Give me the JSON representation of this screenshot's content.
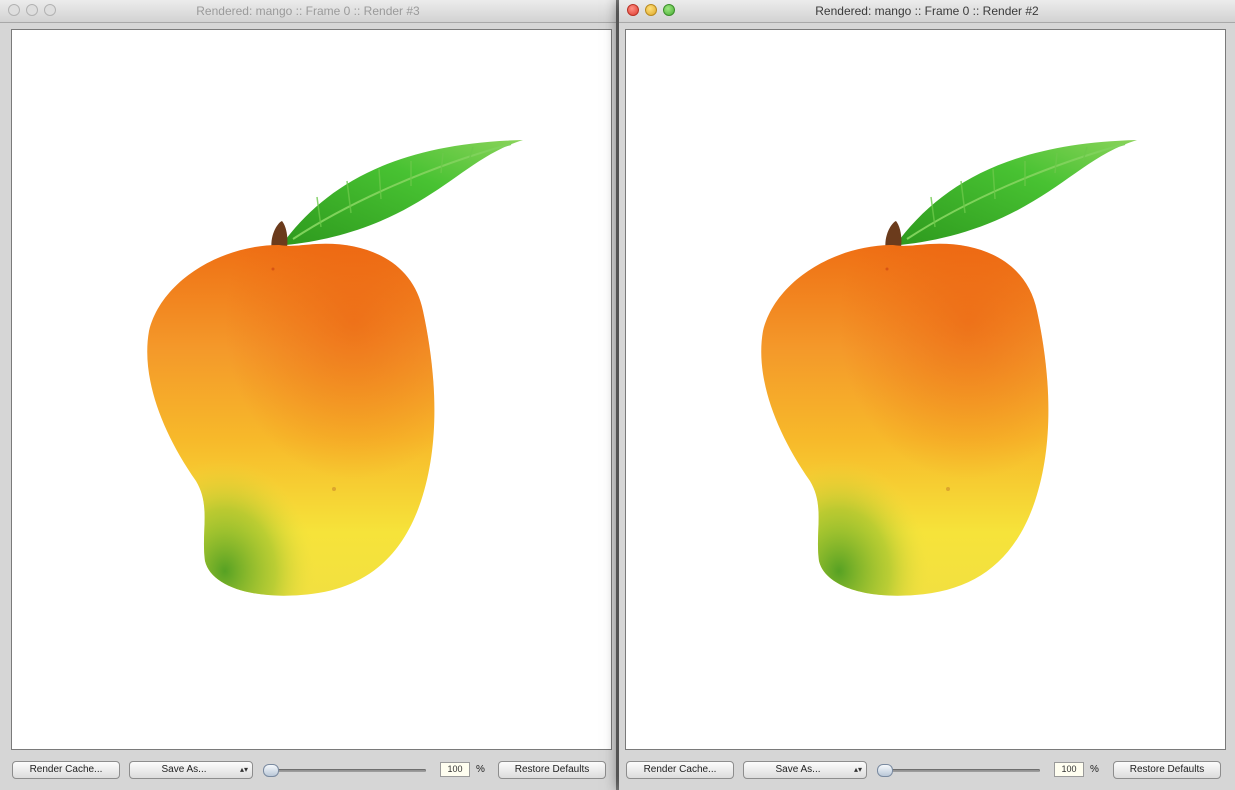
{
  "windows": [
    {
      "title": "Rendered: mango :: Frame 0 :: Render #3",
      "state": "inactive",
      "toolbar": {
        "render_cache_label": "Render Cache...",
        "preset_menu_value": "Save As...",
        "zoom_value": "100",
        "zoom_unit": "%",
        "restore_label": "Restore Defaults"
      }
    },
    {
      "title": "Rendered: mango :: Frame 0 :: Render #2",
      "state": "active",
      "toolbar": {
        "render_cache_label": "Render Cache...",
        "preset_menu_value": "Save As...",
        "zoom_value": "100",
        "zoom_unit": "%",
        "restore_label": "Restore Defaults"
      }
    }
  ],
  "icons": {
    "close": "close-icon",
    "minimize": "minimize-icon",
    "zoom": "zoom-icon",
    "popup": "up-down-arrows-icon"
  },
  "colors": {
    "mango_top": "#ef6f14",
    "mango_mid": "#f7b128",
    "mango_bottom": "#f6e33a",
    "mango_green": "#5aa825",
    "leaf": "#3fbf30",
    "stem": "#6b3b1c",
    "close": "#e0443a",
    "minimize": "#e5b332",
    "zoom": "#57b33f"
  }
}
